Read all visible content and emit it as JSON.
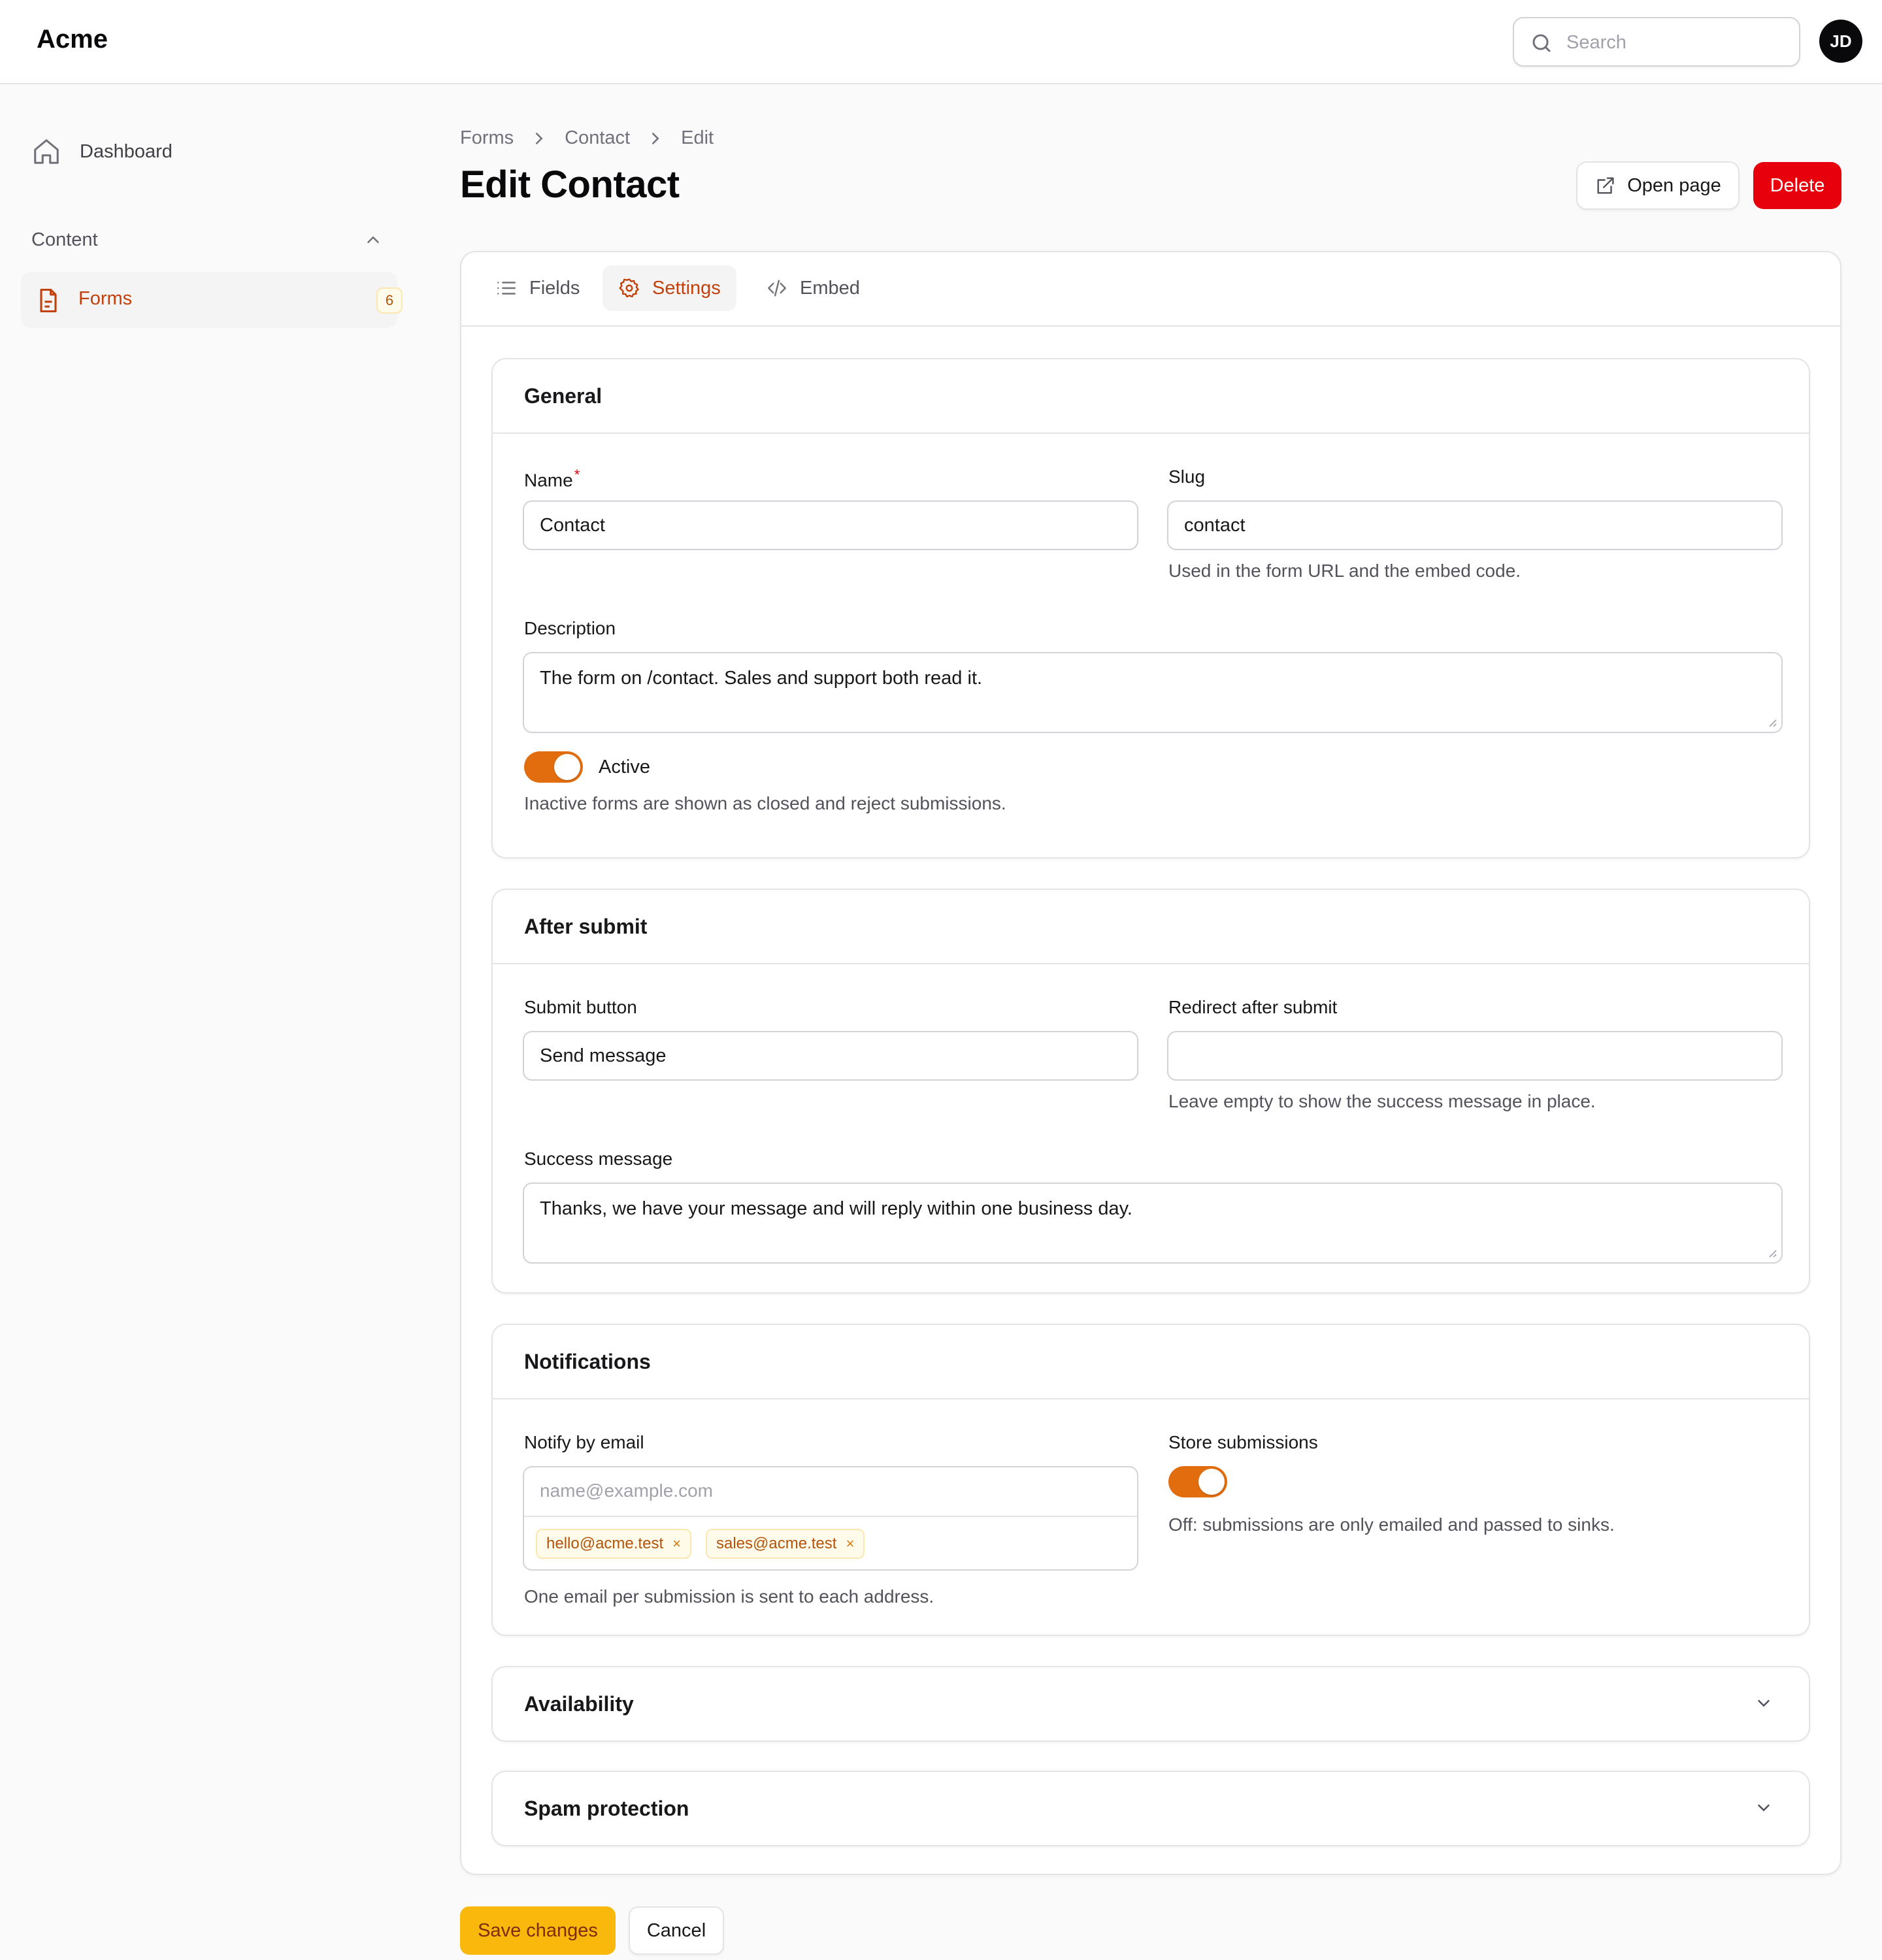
{
  "app": {
    "brand": "Acme"
  },
  "topbar": {
    "search_placeholder": "Search",
    "avatar_initials": "JD"
  },
  "sidebar": {
    "dashboard_label": "Dashboard",
    "group_label": "Content",
    "forms_label": "Forms",
    "forms_count": "6"
  },
  "breadcrumb": [
    "Forms",
    "Contact",
    "Edit"
  ],
  "page": {
    "title": "Edit Contact",
    "open_page_label": "Open page",
    "delete_label": "Delete"
  },
  "tabs": [
    {
      "label": "Fields",
      "icon": "list-icon"
    },
    {
      "label": "Settings",
      "icon": "gear-icon",
      "active": true
    },
    {
      "label": "Embed",
      "icon": "code-icon"
    }
  ],
  "general": {
    "title": "General",
    "name_label": "Name",
    "name_required": "*",
    "name_value": "Contact",
    "slug_label": "Slug",
    "slug_value": "contact",
    "slug_help": "Used in the form URL and the embed code.",
    "description_label": "Description",
    "description_value": "The form on /contact. Sales and support both read it.",
    "active_label": "Active",
    "active_on": true,
    "active_help": "Inactive forms are shown as closed and reject submissions."
  },
  "after_submit": {
    "title": "After submit",
    "submit_button_label": "Submit button",
    "submit_button_value": "Send message",
    "redirect_label": "Redirect after submit",
    "redirect_value": "",
    "redirect_help": "Leave empty to show the success message in place.",
    "success_label": "Success message",
    "success_value": "Thanks, we have your message and will reply within one business day."
  },
  "notifications": {
    "title": "Notifications",
    "notify_label": "Notify by email",
    "notify_placeholder": "name@example.com",
    "emails": [
      "hello@acme.test",
      "sales@acme.test"
    ],
    "notify_help": "One email per submission is sent to each address.",
    "store_label": "Store submissions",
    "store_on": true,
    "store_help": "Off: submissions are only emailed and passed to sinks."
  },
  "availability": {
    "title": "Availability"
  },
  "spam": {
    "title": "Spam protection"
  },
  "footer": {
    "save_label": "Save changes",
    "cancel_label": "Cancel"
  },
  "colors": {
    "accent": "#c2410c",
    "toggle": "#e26d0e",
    "danger": "#e7000b",
    "save": "#f9b80b"
  }
}
